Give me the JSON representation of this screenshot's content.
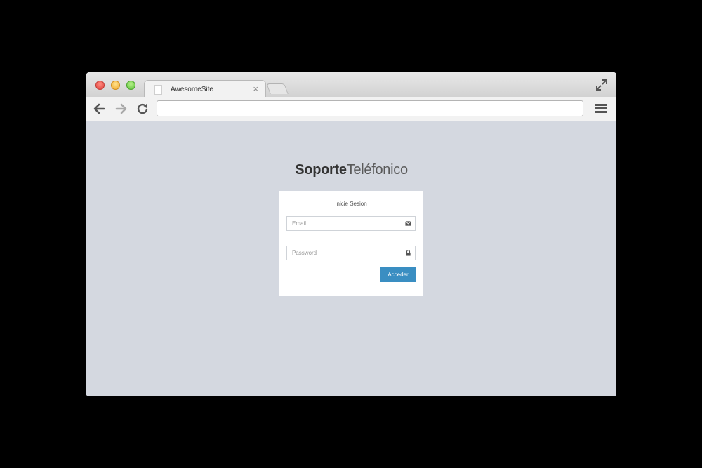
{
  "browser": {
    "tab": {
      "title": "AwesomeSite",
      "close_glyph": "×"
    },
    "address_bar": {
      "value": "",
      "placeholder": ""
    },
    "icons": {
      "back": "arrow-left-icon",
      "forward": "arrow-right-icon",
      "reload": "reload-icon",
      "menu": "hamburger-menu-icon",
      "fullscreen": "fullscreen-icon"
    }
  },
  "page": {
    "brand": {
      "bold": "Soporte",
      "light": "Teléfonico"
    },
    "login": {
      "title": "Inicie Sesion",
      "email_placeholder": "Email",
      "password_placeholder": "Password",
      "submit_label": "Acceder"
    }
  },
  "colors": {
    "page_background": "#d4d8e0",
    "primary_button": "#3a8ec2",
    "card_background": "#ffffff"
  }
}
